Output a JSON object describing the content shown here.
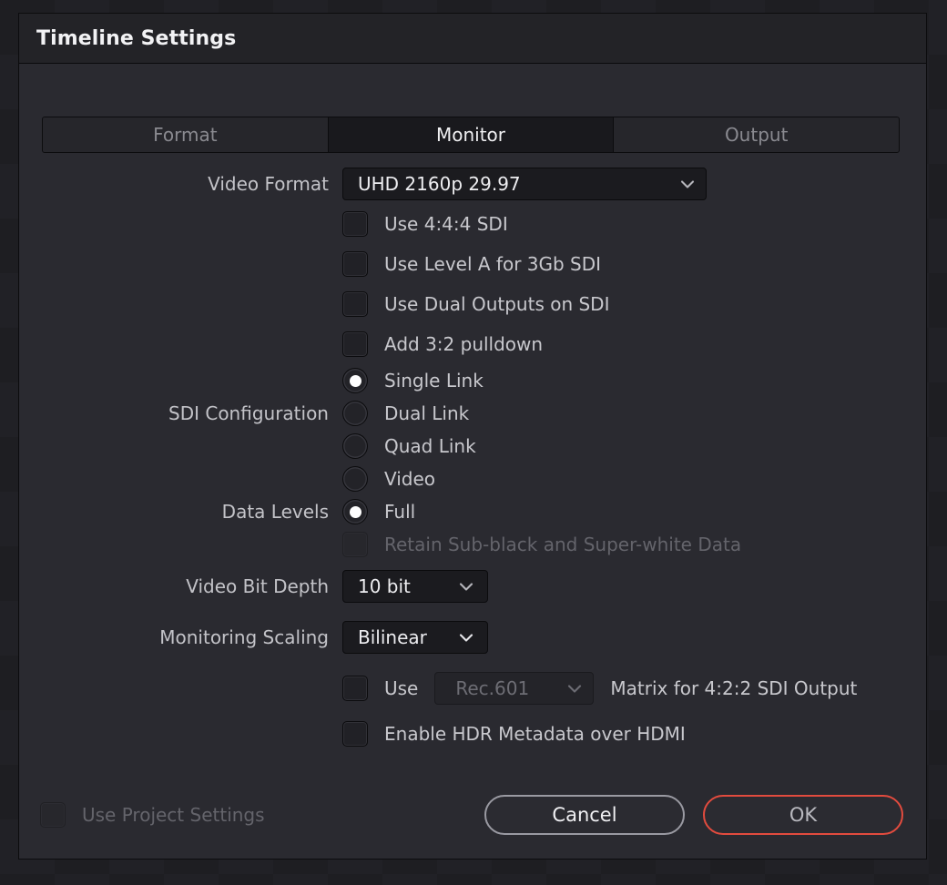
{
  "dialog": {
    "title": "Timeline Settings"
  },
  "tabs": [
    {
      "label": "Format",
      "active": false
    },
    {
      "label": "Monitor",
      "active": true
    },
    {
      "label": "Output",
      "active": false
    }
  ],
  "form": {
    "video_format": {
      "label": "Video Format",
      "value": "UHD 2160p 29.97"
    },
    "sdi_checkboxes": [
      {
        "label": "Use 4:4:4 SDI",
        "checked": false
      },
      {
        "label": "Use Level A for 3Gb SDI",
        "checked": false
      },
      {
        "label": "Use Dual Outputs on SDI",
        "checked": false
      },
      {
        "label": "Add 3:2 pulldown",
        "checked": false
      }
    ],
    "sdi_configuration": {
      "label": "SDI Configuration",
      "options": [
        {
          "label": "Single Link",
          "selected": true
        },
        {
          "label": "Dual Link",
          "selected": false
        },
        {
          "label": "Quad Link",
          "selected": false
        }
      ]
    },
    "data_levels": {
      "label": "Data Levels",
      "options": [
        {
          "label": "Video",
          "selected": false
        },
        {
          "label": "Full",
          "selected": true
        }
      ],
      "retain_checkbox": {
        "label": "Retain Sub-black and Super-white Data",
        "checked": false,
        "disabled": true
      }
    },
    "video_bit_depth": {
      "label": "Video Bit Depth",
      "value": "10 bit"
    },
    "monitoring_scaling": {
      "label": "Monitoring Scaling",
      "value": "Bilinear"
    },
    "matrix_row": {
      "checked": false,
      "prefix": "Use",
      "dropdown_value": "Rec.601",
      "dropdown_disabled": true,
      "suffix": "Matrix for 4:2:2 SDI Output"
    },
    "hdr_metadata": {
      "label": "Enable HDR Metadata over HDMI",
      "checked": false
    }
  },
  "footer": {
    "use_project_settings": {
      "label": "Use Project Settings",
      "checked": false,
      "disabled": true
    },
    "cancel_label": "Cancel",
    "ok_label": "OK"
  },
  "colors": {
    "accent_ok_border": "#e24b3e",
    "dialog_bg": "#2a2a30",
    "titlebar_bg": "#232327",
    "field_bg": "#1b1b1f",
    "text_primary": "#ededf0",
    "text_secondary": "#c3c3c8",
    "text_disabled": "#64646b"
  },
  "icons": {
    "chevron_down": "chevron-down-icon"
  }
}
